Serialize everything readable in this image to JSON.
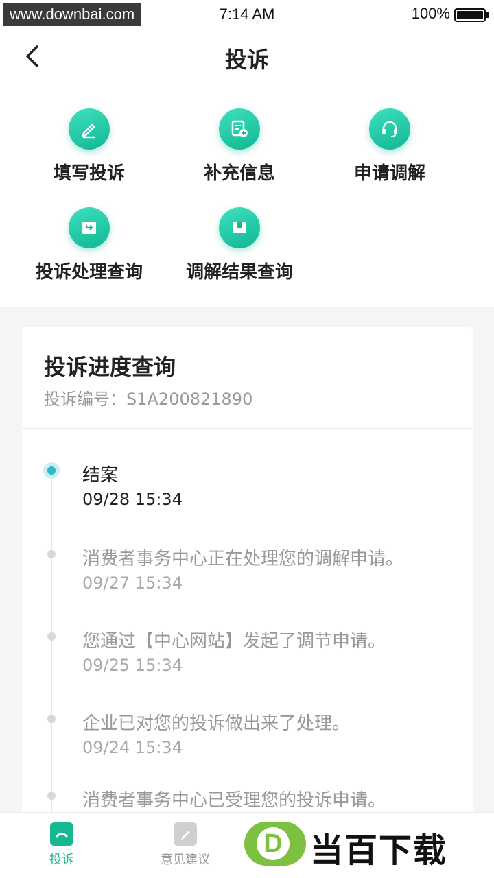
{
  "status_bar": {
    "watermark": "www.downbai.com",
    "time": "7:14 AM",
    "battery": "100%"
  },
  "header": {
    "title": "投诉"
  },
  "functions": [
    {
      "label": "填写投诉",
      "icon": "pencil-icon"
    },
    {
      "label": "补充信息",
      "icon": "document-add-icon"
    },
    {
      "label": "申请调解",
      "icon": "headset-icon"
    },
    {
      "label": "投诉处理查询",
      "icon": "return-box-icon"
    },
    {
      "label": "调解结果查询",
      "icon": "book-icon"
    }
  ],
  "progress": {
    "title": "投诉进度查询",
    "number_label": "投诉编号：S1A200821890",
    "events": [
      {
        "text": "结案",
        "time": "09/28 15:34",
        "active": true
      },
      {
        "text": "消费者事务中心正在处理您的调解申请。",
        "time": "09/27 15:34",
        "active": false
      },
      {
        "text": "您通过【中心网站】发起了调节申请。",
        "time": "09/25 15:34",
        "active": false
      },
      {
        "text": "企业已对您的投诉做出来了处理。",
        "time": "09/24 15:34",
        "active": false
      },
      {
        "text": "消费者事务中心已受理您的投诉申请。",
        "time": "",
        "active": false
      }
    ]
  },
  "tabbar": {
    "tabs": [
      {
        "label": "投诉",
        "active": true
      },
      {
        "label": "意见建议",
        "active": false
      }
    ]
  },
  "brand": {
    "logo_letter": "D",
    "name": "当百下载"
  },
  "colors": {
    "accent": "#17b891",
    "timeline_active": "#2fb7c7",
    "brand_green": "#7cc142"
  }
}
